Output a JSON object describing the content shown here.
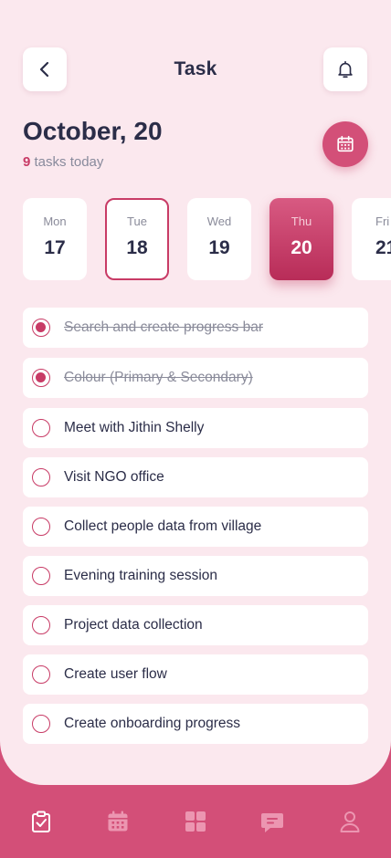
{
  "header": {
    "title": "Task",
    "back_icon": "chevron-left-icon",
    "notification_icon": "bell-icon"
  },
  "summary": {
    "date": "October, 20",
    "task_count": "9",
    "task_suffix": "tasks today",
    "calendar_icon": "calendar-icon"
  },
  "days": [
    {
      "name": "Mon",
      "num": "17",
      "state": "default"
    },
    {
      "name": "Tue",
      "num": "18",
      "state": "outlined"
    },
    {
      "name": "Wed",
      "num": "19",
      "state": "default"
    },
    {
      "name": "Thu",
      "num": "20",
      "state": "active"
    },
    {
      "name": "Fri",
      "num": "21",
      "state": "default"
    }
  ],
  "tasks": [
    {
      "label": "Search and create progress bar",
      "done": true
    },
    {
      "label": "Colour (Primary & Secondary)",
      "done": true
    },
    {
      "label": "Meet with Jithin Shelly",
      "done": false
    },
    {
      "label": "Visit NGO office",
      "done": false
    },
    {
      "label": "Collect people data from village",
      "done": false
    },
    {
      "label": "Evening training session",
      "done": false
    },
    {
      "label": "Project data collection",
      "done": false
    },
    {
      "label": "Create user flow",
      "done": false
    },
    {
      "label": "Create onboarding progress",
      "done": false
    }
  ],
  "nav": {
    "items": [
      "tasks-icon",
      "calendar-icon",
      "dashboard-icon",
      "chat-icon",
      "profile-icon"
    ],
    "active": "tasks-icon"
  },
  "colors": {
    "accent": "#c83b66",
    "nav_background": "#d34f78",
    "screen_background": "#fbe8ee",
    "text_primary": "#2b2d48",
    "text_secondary": "#888a9c"
  }
}
